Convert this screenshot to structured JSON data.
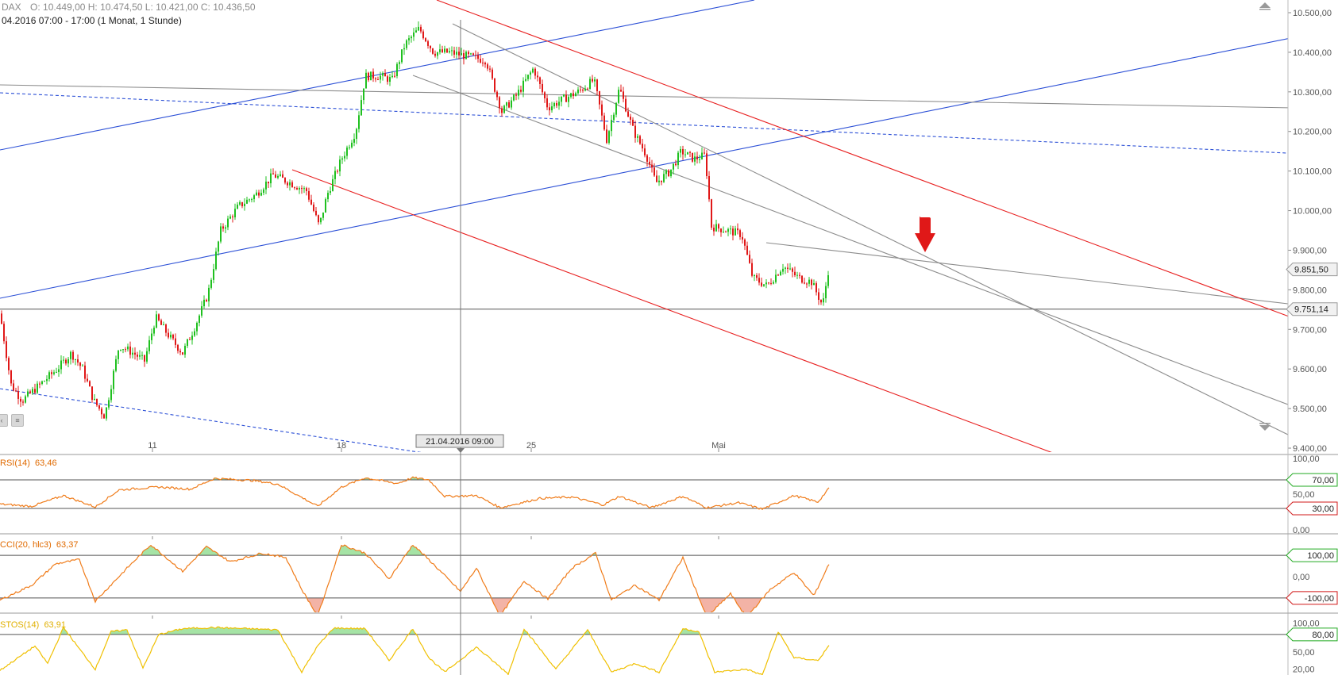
{
  "header": {
    "symbol": "DAX",
    "ohlc": "O: 10.449,00   H: 10.474,50   L: 10.421,00   C: 10.436,50",
    "range": "04.2016 07:00 - 17:00 (1 Monat, 1 Stunde)"
  },
  "crosshair": {
    "date_label": "21.04.2016 09:00"
  },
  "chart_data": [
    {
      "type": "candlestick",
      "xlabel": "",
      "ylabel": "",
      "ylim": [
        9400,
        10500
      ],
      "y_ticks": [
        "10.500,00",
        "10.400,00",
        "10.300,00",
        "10.200,00",
        "10.100,00",
        "10.000,00",
        "9.900,00",
        "9.800,00",
        "9.700,00",
        "9.600,00",
        "9.500,00",
        "9.400,00"
      ],
      "x_ticks": [
        "11",
        "18",
        "25",
        "Mai"
      ],
      "price_tags": [
        {
          "label": "9.851,50",
          "value": 9851.5
        },
        {
          "label": "9.751,14",
          "value": 9751.14
        }
      ],
      "colors": {
        "up": "#1fc01f",
        "down": "#e01818",
        "channel": "#e82020",
        "trend": "#2b4fd6",
        "helper": "#8c8c8c"
      },
      "waypoints": [
        [
          0,
          9740
        ],
        [
          14,
          9560
        ],
        [
          28,
          9520
        ],
        [
          50,
          9560
        ],
        [
          72,
          9600
        ],
        [
          90,
          9640
        ],
        [
          104,
          9600
        ],
        [
          118,
          9520
        ],
        [
          132,
          9480
        ],
        [
          150,
          9660
        ],
        [
          168,
          9640
        ],
        [
          182,
          9620
        ],
        [
          196,
          9730
        ],
        [
          214,
          9680
        ],
        [
          230,
          9640
        ],
        [
          246,
          9710
        ],
        [
          262,
          9790
        ],
        [
          278,
          9950
        ],
        [
          300,
          10010
        ],
        [
          322,
          10040
        ],
        [
          344,
          10090
        ],
        [
          366,
          10070
        ],
        [
          386,
          10050
        ],
        [
          402,
          9960
        ],
        [
          412,
          10040
        ],
        [
          430,
          10130
        ],
        [
          448,
          10200
        ],
        [
          460,
          10340
        ],
        [
          478,
          10340
        ],
        [
          494,
          10330
        ],
        [
          510,
          10420
        ],
        [
          528,
          10460
        ],
        [
          546,
          10400
        ],
        [
          566,
          10400
        ],
        [
          588,
          10390
        ],
        [
          612,
          10380
        ],
        [
          632,
          10250
        ],
        [
          650,
          10290
        ],
        [
          672,
          10360
        ],
        [
          690,
          10260
        ],
        [
          708,
          10280
        ],
        [
          728,
          10300
        ],
        [
          748,
          10330
        ],
        [
          764,
          10180
        ],
        [
          780,
          10310
        ],
        [
          798,
          10200
        ],
        [
          814,
          10140
        ],
        [
          826,
          10070
        ],
        [
          844,
          10100
        ],
        [
          858,
          10150
        ],
        [
          874,
          10130
        ],
        [
          888,
          10140
        ],
        [
          896,
          9960
        ],
        [
          916,
          9950
        ],
        [
          934,
          9940
        ],
        [
          948,
          9830
        ],
        [
          966,
          9810
        ],
        [
          986,
          9860
        ],
        [
          1006,
          9830
        ],
        [
          1022,
          9820
        ],
        [
          1036,
          9760
        ],
        [
          1044,
          9860
        ]
      ]
    },
    {
      "type": "line",
      "name": "RSI(14)",
      "label_value": "63,46",
      "ylim": [
        0,
        100
      ],
      "y_ticks": [
        "100,00",
        "50,00",
        "0,00"
      ],
      "levels": [
        {
          "label": "70,00",
          "value": 70
        },
        {
          "label": "30,00",
          "value": 30
        }
      ],
      "line_color": "#f07c1a",
      "waypoints": [
        [
          0,
          36
        ],
        [
          40,
          33
        ],
        [
          80,
          48
        ],
        [
          120,
          32
        ],
        [
          150,
          56
        ],
        [
          200,
          60
        ],
        [
          240,
          57
        ],
        [
          270,
          72
        ],
        [
          320,
          69
        ],
        [
          350,
          64
        ],
        [
          400,
          33
        ],
        [
          430,
          60
        ],
        [
          460,
          73
        ],
        [
          500,
          65
        ],
        [
          520,
          73
        ],
        [
          540,
          70
        ],
        [
          560,
          47
        ],
        [
          600,
          48
        ],
        [
          630,
          31
        ],
        [
          680,
          44
        ],
        [
          720,
          46
        ],
        [
          760,
          35
        ],
        [
          780,
          47
        ],
        [
          820,
          31
        ],
        [
          860,
          47
        ],
        [
          890,
          31
        ],
        [
          930,
          38
        ],
        [
          960,
          29
        ],
        [
          1000,
          48
        ],
        [
          1030,
          39
        ],
        [
          1044,
          58
        ]
      ]
    },
    {
      "type": "line",
      "name": "CCI(20, hlc3)",
      "label_value": "63,37",
      "ylim": [
        -160,
        175
      ],
      "y_ticks": [
        "0,00"
      ],
      "levels": [
        {
          "label": "100,00",
          "value": 100
        },
        {
          "label": "-100,00",
          "value": -100
        }
      ],
      "line_color": "#f07c1a",
      "waypoints": [
        [
          0,
          -110
        ],
        [
          40,
          -40
        ],
        [
          70,
          60
        ],
        [
          100,
          80
        ],
        [
          120,
          -115
        ],
        [
          160,
          40
        ],
        [
          190,
          150
        ],
        [
          230,
          25
        ],
        [
          260,
          140
        ],
        [
          290,
          70
        ],
        [
          330,
          110
        ],
        [
          360,
          90
        ],
        [
          380,
          -60
        ],
        [
          400,
          -185
        ],
        [
          430,
          150
        ],
        [
          460,
          110
        ],
        [
          490,
          -10
        ],
        [
          520,
          150
        ],
        [
          540,
          80
        ],
        [
          580,
          -70
        ],
        [
          600,
          40
        ],
        [
          630,
          -185
        ],
        [
          660,
          -20
        ],
        [
          690,
          -105
        ],
        [
          720,
          40
        ],
        [
          750,
          110
        ],
        [
          770,
          -110
        ],
        [
          800,
          -40
        ],
        [
          830,
          -110
        ],
        [
          860,
          90
        ],
        [
          890,
          -190
        ],
        [
          920,
          -80
        ],
        [
          940,
          -190
        ],
        [
          970,
          -60
        ],
        [
          1000,
          20
        ],
        [
          1025,
          -90
        ],
        [
          1044,
          60
        ]
      ]
    },
    {
      "type": "line",
      "name": "STOS(14)",
      "label_value": "63,91",
      "ylim": [
        10,
        110
      ],
      "y_ticks": [
        "100,00",
        "50,00",
        "20,00"
      ],
      "levels": [
        {
          "label": "80,00",
          "value": 80
        }
      ],
      "line_color": "#f0c000",
      "waypoints": [
        [
          0,
          18
        ],
        [
          44,
          60
        ],
        [
          60,
          30
        ],
        [
          80,
          92
        ],
        [
          100,
          55
        ],
        [
          120,
          20
        ],
        [
          140,
          85
        ],
        [
          160,
          88
        ],
        [
          180,
          22
        ],
        [
          200,
          80
        ],
        [
          230,
          90
        ],
        [
          270,
          92
        ],
        [
          310,
          90
        ],
        [
          350,
          88
        ],
        [
          380,
          15
        ],
        [
          400,
          60
        ],
        [
          420,
          91
        ],
        [
          460,
          90
        ],
        [
          490,
          35
        ],
        [
          520,
          90
        ],
        [
          540,
          40
        ],
        [
          560,
          15
        ],
        [
          600,
          58
        ],
        [
          640,
          12
        ],
        [
          660,
          90
        ],
        [
          700,
          20
        ],
        [
          740,
          88
        ],
        [
          770,
          15
        ],
        [
          800,
          30
        ],
        [
          830,
          15
        ],
        [
          860,
          90
        ],
        [
          880,
          85
        ],
        [
          900,
          15
        ],
        [
          940,
          20
        ],
        [
          960,
          10
        ],
        [
          980,
          85
        ],
        [
          1000,
          40
        ],
        [
          1030,
          35
        ],
        [
          1044,
          60
        ]
      ]
    }
  ],
  "signal": {
    "icon": "down-arrow-icon",
    "color": "#e01818"
  },
  "toolbar": {
    "scroll_up_icon": "triangle-up-icon",
    "scroll_down_icon": "triangle-down-icon"
  }
}
